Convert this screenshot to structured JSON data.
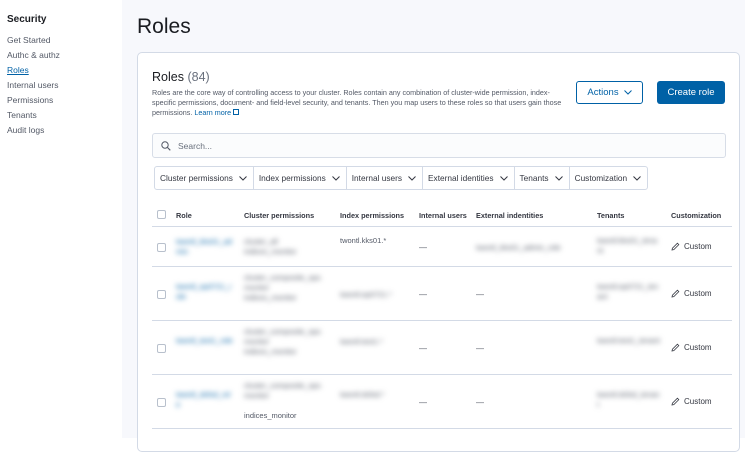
{
  "sidebar": {
    "heading": "Security",
    "items": [
      {
        "label": "Get Started",
        "active": false
      },
      {
        "label": "Authc & authz",
        "active": false
      },
      {
        "label": "Roles",
        "active": true
      },
      {
        "label": "Internal users",
        "active": false
      },
      {
        "label": "Permissions",
        "active": false
      },
      {
        "label": "Tenants",
        "active": false
      },
      {
        "label": "Audit logs",
        "active": false
      }
    ]
  },
  "page": {
    "title": "Roles"
  },
  "panel": {
    "title": "Roles",
    "count": "(84)",
    "description": "Roles are the core way of controlling access to your cluster. Roles contain any combination of cluster-wide permission, index-specific permissions, document- and field-level security, and tenants. Then you map users to these roles so that users gain those permissions.",
    "learn_more": "Learn more",
    "actions_label": "Actions",
    "create_label": "Create role"
  },
  "search": {
    "placeholder": "Search..."
  },
  "filters": [
    "Cluster permissions",
    "Index permissions",
    "Internal users",
    "External identities",
    "Tenants",
    "Customization"
  ],
  "table": {
    "headers": [
      "Role",
      "Cluster permissions",
      "Index permissions",
      "Internal users",
      "External indentities",
      "Tenants",
      "Customization"
    ],
    "rows": [
      {
        "role": "twontl_kks01_admin",
        "cluster": "cluster_all\nindices_monitor",
        "index": "twontl.kks01.*",
        "users": "—",
        "external": "twontl_kks01_admin_role",
        "tenants": "twontl.kks01_tenant",
        "customization": "Custom"
      },
      {
        "role": "twontl_ep0721_role",
        "cluster": "cluster_composite_ops\nmonitor\nindices_monitor",
        "index": "twontl.ep0721.*",
        "users": "—",
        "external": "—",
        "tenants": "twontl.ep0721_tenant",
        "customization": "Custom"
      },
      {
        "role": "twontl_test1_role",
        "cluster": "cluster_composite_ops\nmonitor\nindices_monitor",
        "index": "twontl.test1.*",
        "users": "—",
        "external": "—",
        "tenants": "twontl.test1_tenant",
        "customization": "Custom"
      },
      {
        "role": "twontl_dsfsd_role",
        "cluster": "cluster_composite_ops\nmonitor",
        "cluster_visible": "indices_monitor",
        "index": "twontl.dsfsd.*",
        "users": "—",
        "external": "—",
        "tenants": "twontl.dsfsd_tenant",
        "customization": "Custom"
      }
    ]
  },
  "colors": {
    "primary": "#0061a6",
    "text": "#343741",
    "border": "#d3dae6",
    "page_bg": "#f7f8fc"
  },
  "icons": {
    "search": "search-icon",
    "chevron": "chevron-down-icon",
    "pencil": "pencil-icon",
    "external": "external-link-icon"
  }
}
